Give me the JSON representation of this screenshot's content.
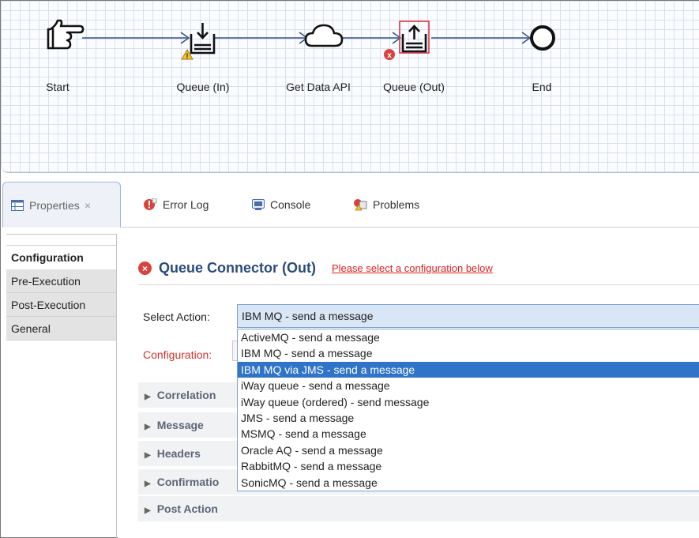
{
  "flow": {
    "nodes": [
      {
        "label": "Start",
        "icon": "pointing-hand-icon"
      },
      {
        "label": "Queue (In)",
        "icon": "inbox-download-icon",
        "badge": "warning"
      },
      {
        "label": "Get Data API",
        "icon": "cloud-icon"
      },
      {
        "label": "Queue (Out)",
        "icon": "inbox-upload-icon",
        "badge": "error"
      },
      {
        "label": "End",
        "icon": "end-circle-icon"
      }
    ]
  },
  "tabs": [
    {
      "label": "Properties",
      "icon": "properties-icon",
      "close": "×",
      "active": true
    },
    {
      "label": "Error Log",
      "icon": "error-log-icon"
    },
    {
      "label": "Console",
      "icon": "console-icon"
    },
    {
      "label": "Problems",
      "icon": "problems-icon"
    }
  ],
  "nav": {
    "items": [
      "Configuration",
      "Pre-Execution",
      "Post-Execution",
      "General"
    ],
    "active_index": 0
  },
  "panel": {
    "title": "Queue Connector (Out)",
    "warning": "Please select a configuration below",
    "select_action_label": "Select Action:",
    "select_action_value": "IBM MQ - send a message",
    "configuration_label": "Configuration:",
    "sections": [
      "Correlation",
      "Message",
      "Headers",
      "Confirmatio",
      "Post Action"
    ]
  },
  "dropdown": {
    "options": [
      "ActiveMQ - send a message",
      "IBM MQ - send a message",
      "IBM MQ via JMS - send a message",
      "iWay queue - send a message",
      "iWay queue (ordered) - send message",
      "JMS - send a message",
      "MSMQ - send a message",
      "Oracle AQ - send a message",
      "RabbitMQ - send a message",
      "SonicMQ - send a message"
    ],
    "highlighted_index": 2
  },
  "colors": {
    "title": "#2a4b7c",
    "warning": "#e02020",
    "highlight": "#2f74c8",
    "select_bg": "#d9e6f6"
  }
}
